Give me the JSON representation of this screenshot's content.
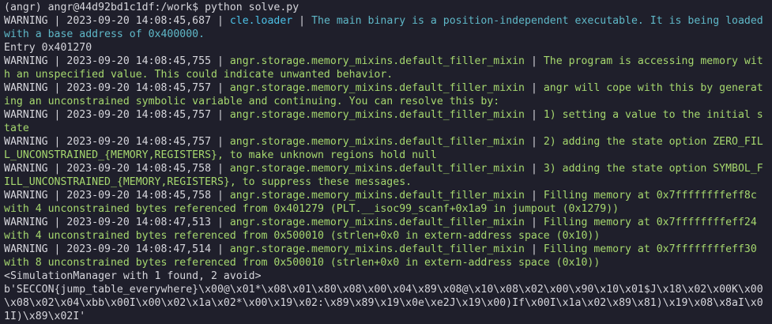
{
  "colors": {
    "background": "#1f1f2b",
    "default": "#d6d6dc",
    "logger_loader": "#4cc0e6",
    "message_loader": "#5fb8c8",
    "logger_filler": "#a6d86e",
    "message_filler": "#a6d86e"
  },
  "terminal": {
    "lines": [
      [
        {
          "text": "(angr) angr@44d92bd1c1df:/work$ python solve.py",
          "color": "default"
        }
      ],
      [
        {
          "text": "WARNING | 2023-09-20 14:08:45,687 | ",
          "color": "default"
        },
        {
          "text": "cle.loader",
          "color": "logger_loader"
        },
        {
          "text": " | ",
          "color": "default"
        },
        {
          "text": "The main binary is a position-independent executable. It is being loaded with a base address of 0x400000.",
          "color": "message_loader"
        }
      ],
      [
        {
          "text": "Entry 0x401270",
          "color": "default"
        }
      ],
      [
        {
          "text": "WARNING | 2023-09-20 14:08:45,755 | ",
          "color": "default"
        },
        {
          "text": "angr.storage.memory_mixins.default_filler_mixin",
          "color": "logger_filler"
        },
        {
          "text": " | ",
          "color": "default"
        },
        {
          "text": "The program is accessing memory with an unspecified value. This could indicate unwanted behavior.",
          "color": "message_filler"
        }
      ],
      [
        {
          "text": "WARNING | 2023-09-20 14:08:45,757 | ",
          "color": "default"
        },
        {
          "text": "angr.storage.memory_mixins.default_filler_mixin",
          "color": "logger_filler"
        },
        {
          "text": " | ",
          "color": "default"
        },
        {
          "text": "angr will cope with this by generating an unconstrained symbolic variable and continuing. You can resolve this by:",
          "color": "message_filler"
        }
      ],
      [
        {
          "text": "WARNING | 2023-09-20 14:08:45,757 | ",
          "color": "default"
        },
        {
          "text": "angr.storage.memory_mixins.default_filler_mixin",
          "color": "logger_filler"
        },
        {
          "text": " | ",
          "color": "default"
        },
        {
          "text": "1) setting a value to the initial state",
          "color": "message_filler"
        }
      ],
      [
        {
          "text": "WARNING | 2023-09-20 14:08:45,757 | ",
          "color": "default"
        },
        {
          "text": "angr.storage.memory_mixins.default_filler_mixin",
          "color": "logger_filler"
        },
        {
          "text": " | ",
          "color": "default"
        },
        {
          "text": "2) adding the state option ZERO_FILL_UNCONSTRAINED_{MEMORY,REGISTERS}, to make unknown regions hold null",
          "color": "message_filler"
        }
      ],
      [
        {
          "text": "WARNING | 2023-09-20 14:08:45,758 | ",
          "color": "default"
        },
        {
          "text": "angr.storage.memory_mixins.default_filler_mixin",
          "color": "logger_filler"
        },
        {
          "text": " | ",
          "color": "default"
        },
        {
          "text": "3) adding the state option SYMBOL_FILL_UNCONSTRAINED_{MEMORY,REGISTERS}, to suppress these messages.",
          "color": "message_filler"
        }
      ],
      [
        {
          "text": "WARNING | 2023-09-20 14:08:45,758 | ",
          "color": "default"
        },
        {
          "text": "angr.storage.memory_mixins.default_filler_mixin",
          "color": "logger_filler"
        },
        {
          "text": " | ",
          "color": "default"
        },
        {
          "text": "Filling memory at 0x7ffffffffeff8c with 4 unconstrained bytes referenced from 0x401279 (PLT.__isoc99_scanf+0x1a9 in jumpout (0x1279))",
          "color": "message_filler"
        }
      ],
      [
        {
          "text": "WARNING | 2023-09-20 14:08:47,513 | ",
          "color": "default"
        },
        {
          "text": "angr.storage.memory_mixins.default_filler_mixin",
          "color": "logger_filler"
        },
        {
          "text": " | ",
          "color": "default"
        },
        {
          "text": "Filling memory at 0x7ffffffffeff24 with 4 unconstrained bytes referenced from 0x500010 (strlen+0x0 in extern-address space (0x10))",
          "color": "message_filler"
        }
      ],
      [
        {
          "text": "WARNING | 2023-09-20 14:08:47,514 | ",
          "color": "default"
        },
        {
          "text": "angr.storage.memory_mixins.default_filler_mixin",
          "color": "logger_filler"
        },
        {
          "text": " | ",
          "color": "default"
        },
        {
          "text": "Filling memory at 0x7ffffffffeff30 with 8 unconstrained bytes referenced from 0x500010 (strlen+0x0 in extern-address space (0x10))",
          "color": "message_filler"
        }
      ],
      [
        {
          "text": "<SimulationManager with 1 found, 2 avoid>",
          "color": "default"
        }
      ],
      [
        {
          "text": "b'SECCON{jump_table_everywhere}\\x00@\\x01*\\x08\\x01\\x80\\x08\\x00\\x04\\x89\\x08@\\x10\\x08\\x02\\x00\\x90\\x10\\x01$J\\x18\\x02\\x00K\\x00\\x08\\x02\\x04\\xbb\\x00I\\x00\\x02\\x1a\\x02*\\x00\\x19\\x02:\\x89\\x89\\x19\\x0e\\xe2J\\x19\\x00)If\\x00I\\x1a\\x02\\x89\\x81)\\x19\\x08\\x8aI\\x01I)\\x89\\x02I'",
          "color": "default"
        }
      ],
      [
        {
          "text": "(angr) angr@44d92bd1c1df:/work$ ",
          "color": "default"
        }
      ]
    ]
  }
}
